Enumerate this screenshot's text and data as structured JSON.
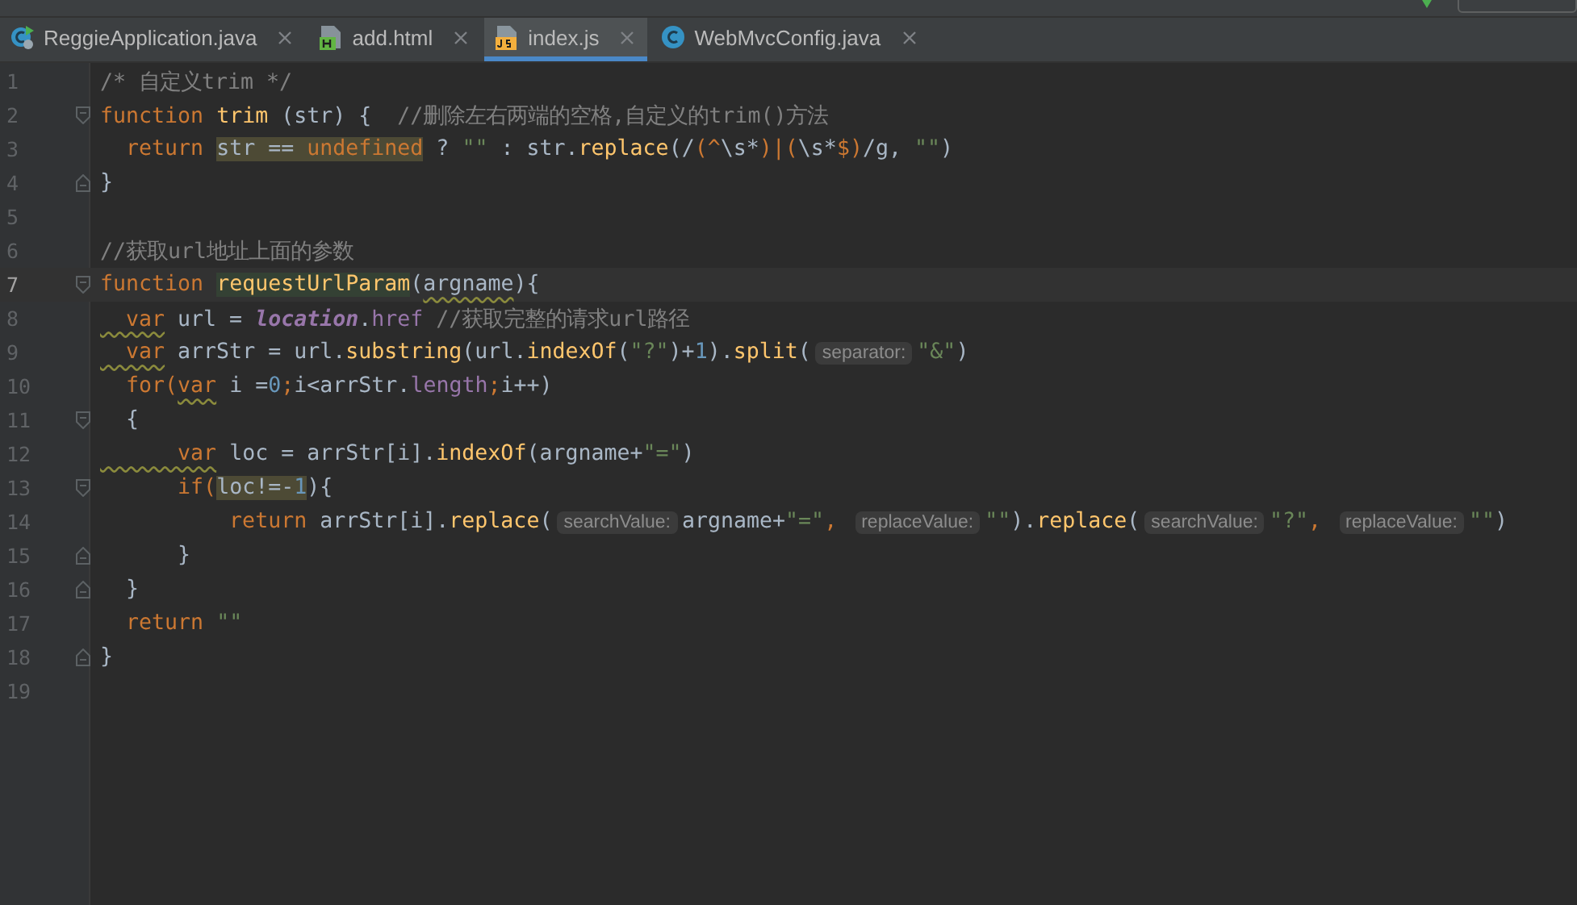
{
  "tabs": [
    {
      "label": "ReggieApplication.java",
      "kind": "javarun",
      "selected": false
    },
    {
      "label": "add.html",
      "kind": "html",
      "selected": false
    },
    {
      "label": "index.js",
      "kind": "js",
      "selected": true
    },
    {
      "label": "WebMvcConfig.java",
      "kind": "java",
      "selected": false
    }
  ],
  "lines": [
    {
      "number": "1",
      "kind": "code",
      "current": false,
      "tokens": [
        {
          "text": "/* 自定义trim */",
          "kind": "comment"
        }
      ]
    },
    {
      "number": "2",
      "kind": "foldopen",
      "current": false,
      "tokens": [
        {
          "text": "function ",
          "kind": "keyword"
        },
        {
          "text": "trim",
          "kind": "function"
        },
        {
          "text": " (str) {  ",
          "kind": "plain"
        },
        {
          "text": "//删除左右两端的空格,自定义的trim()方法",
          "kind": "comment"
        }
      ]
    },
    {
      "number": "3",
      "kind": "code",
      "current": false,
      "tokens": [
        {
          "text": "  return ",
          "kind": "keyword"
        },
        {
          "text": "str == ",
          "kind": "highlight"
        },
        {
          "text": "undefined",
          "kind": "highlightkeyword"
        },
        {
          "text": " ? ",
          "kind": "plain"
        },
        {
          "text": "\"\"",
          "kind": "string"
        },
        {
          "text": " : str.",
          "kind": "plain"
        },
        {
          "text": "replace",
          "kind": "function"
        },
        {
          "text": "(/",
          "kind": "plain"
        },
        {
          "text": "(^",
          "kind": "keyword"
        },
        {
          "text": "\\s*",
          "kind": "plain"
        },
        {
          "text": ")|(",
          "kind": "keyword"
        },
        {
          "text": "\\s*",
          "kind": "plain"
        },
        {
          "text": "$)",
          "kind": "keyword"
        },
        {
          "text": "/g, ",
          "kind": "plain"
        },
        {
          "text": "\"\"",
          "kind": "string"
        },
        {
          "text": ")",
          "kind": "plain"
        }
      ]
    },
    {
      "number": "4",
      "kind": "foldclose",
      "current": false,
      "tokens": [
        {
          "text": "}",
          "kind": "plain"
        }
      ]
    },
    {
      "number": "5",
      "kind": "code",
      "current": false
    },
    {
      "number": "6",
      "kind": "code",
      "current": false,
      "tokens": [
        {
          "text": "//获取url地址上面的参数",
          "kind": "comment"
        }
      ]
    },
    {
      "number": "7",
      "kind": "foldopen",
      "current": true,
      "tokens": [
        {
          "text": "function ",
          "kind": "keyword"
        },
        {
          "text": "requestUrlParam",
          "kind": "definition"
        },
        {
          "text": "(",
          "kind": "plain"
        },
        {
          "text": "argname",
          "kind": "warnplain"
        },
        {
          "text": "){",
          "kind": "plain"
        }
      ]
    },
    {
      "number": "8",
      "kind": "code",
      "current": false,
      "tokens": [
        {
          "text": "  var",
          "kind": "warnkeyword"
        },
        {
          "text": " url = ",
          "kind": "plain"
        },
        {
          "text": "location",
          "kind": "global"
        },
        {
          "text": ".",
          "kind": "plain"
        },
        {
          "text": "href ",
          "kind": "property"
        },
        {
          "text": "//获取完整的请求url路径",
          "kind": "comment"
        }
      ]
    },
    {
      "number": "9",
      "kind": "code",
      "current": false,
      "tokens": [
        {
          "text": "  var",
          "kind": "warnkeyword"
        },
        {
          "text": " arrStr = url.",
          "kind": "plain"
        },
        {
          "text": "substring",
          "kind": "function"
        },
        {
          "text": "(url.",
          "kind": "plain"
        },
        {
          "text": "indexOf",
          "kind": "function"
        },
        {
          "text": "(",
          "kind": "plain"
        },
        {
          "text": "\"?\"",
          "kind": "string"
        },
        {
          "text": ")+",
          "kind": "plain"
        },
        {
          "text": "1",
          "kind": "number"
        },
        {
          "text": ").",
          "kind": "plain"
        },
        {
          "text": "split",
          "kind": "function"
        },
        {
          "text": "(",
          "kind": "plain"
        },
        {
          "text": "separator:",
          "kind": "hint"
        },
        {
          "text": "\"&\"",
          "kind": "string"
        },
        {
          "text": ")",
          "kind": "plain"
        }
      ]
    },
    {
      "number": "10",
      "kind": "code",
      "current": false,
      "tokens": [
        {
          "text": "  for(",
          "kind": "keyword"
        },
        {
          "text": "var",
          "kind": "warnkeyword"
        },
        {
          "text": " i =",
          "kind": "plain"
        },
        {
          "text": "0",
          "kind": "number"
        },
        {
          "text": ";",
          "kind": "keyword"
        },
        {
          "text": "i<arrStr.",
          "kind": "plain"
        },
        {
          "text": "length",
          "kind": "property"
        },
        {
          "text": ";",
          "kind": "keyword"
        },
        {
          "text": "i++)",
          "kind": "plain"
        }
      ]
    },
    {
      "number": "11",
      "kind": "foldopen",
      "current": false,
      "tokens": [
        {
          "text": "  {",
          "kind": "plain"
        }
      ]
    },
    {
      "number": "12",
      "kind": "code",
      "current": false,
      "tokens": [
        {
          "text": "      var",
          "kind": "warnkeyword"
        },
        {
          "text": " loc = arrStr[i].",
          "kind": "plain"
        },
        {
          "text": "indexOf",
          "kind": "function"
        },
        {
          "text": "(argname+",
          "kind": "plain"
        },
        {
          "text": "\"=\"",
          "kind": "string"
        },
        {
          "text": ")",
          "kind": "plain"
        }
      ]
    },
    {
      "number": "13",
      "kind": "foldopen",
      "current": false,
      "tokens": [
        {
          "text": "      if(",
          "kind": "keyword"
        },
        {
          "text": "loc!=-",
          "kind": "highlight"
        },
        {
          "text": "1",
          "kind": "highlightnumber"
        },
        {
          "text": "){",
          "kind": "plain"
        }
      ]
    },
    {
      "number": "14",
      "kind": "code",
      "current": false,
      "tokens": [
        {
          "text": "          return",
          "kind": "keyword"
        },
        {
          "text": " arrStr[i].",
          "kind": "plain"
        },
        {
          "text": "replace",
          "kind": "function"
        },
        {
          "text": "(",
          "kind": "plain"
        },
        {
          "text": "searchValue:",
          "kind": "hint"
        },
        {
          "text": "argname+",
          "kind": "plain"
        },
        {
          "text": "\"=\"",
          "kind": "string"
        },
        {
          "text": ", ",
          "kind": "keyword"
        },
        {
          "text": "replaceValue:",
          "kind": "hint"
        },
        {
          "text": "\"\"",
          "kind": "string"
        },
        {
          "text": ").",
          "kind": "plain"
        },
        {
          "text": "replace",
          "kind": "function"
        },
        {
          "text": "(",
          "kind": "plain"
        },
        {
          "text": "searchValue:",
          "kind": "hint"
        },
        {
          "text": "\"?\"",
          "kind": "string"
        },
        {
          "text": ", ",
          "kind": "keyword"
        },
        {
          "text": "replaceValue:",
          "kind": "hint"
        },
        {
          "text": "\"\"",
          "kind": "string"
        },
        {
          "text": ")",
          "kind": "plain"
        }
      ]
    },
    {
      "number": "15",
      "kind": "foldclose",
      "current": false,
      "tokens": [
        {
          "text": "      }",
          "kind": "plain"
        }
      ]
    },
    {
      "number": "16",
      "kind": "foldclose",
      "current": false,
      "tokens": [
        {
          "text": "  }",
          "kind": "plain"
        }
      ]
    },
    {
      "number": "17",
      "kind": "code",
      "current": false,
      "tokens": [
        {
          "text": "  return ",
          "kind": "keyword"
        },
        {
          "text": "\"\"",
          "kind": "string"
        }
      ]
    },
    {
      "number": "18",
      "kind": "foldclose",
      "current": false,
      "tokens": [
        {
          "text": "}",
          "kind": "plain"
        }
      ]
    },
    {
      "number": "19",
      "kind": "code",
      "current": false
    }
  ]
}
